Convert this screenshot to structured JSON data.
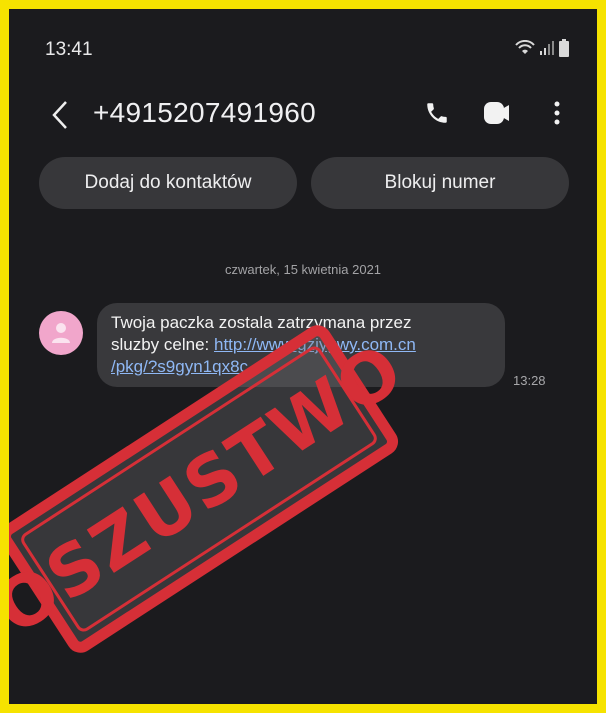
{
  "status_bar": {
    "time": "13:41",
    "icons": [
      "wifi-icon",
      "signal-icon",
      "battery-icon"
    ]
  },
  "header": {
    "back_icon": "chevron-left-icon",
    "phone_number": "+4915207491960",
    "actions": [
      "phone-icon",
      "video-call-icon",
      "more-icon"
    ]
  },
  "actions": {
    "add_contact": "Dodaj do kontaktów",
    "block_number": "Blokuj numer"
  },
  "conversation": {
    "date": "czwartek, 15 kwietnia 2021",
    "messages": [
      {
        "text_line1": "Twoja paczka zostala zatrzymana przez",
        "text_line2_prefix": "sluzby celne: ",
        "link_part1": "http://www.gzjygwy.com.cn",
        "link_part2": "/pkg/?s9gyn1qx8c",
        "time": "13:28"
      }
    ]
  },
  "stamp": {
    "text": "OSZUSTWO",
    "color": "#d62f37"
  },
  "colors": {
    "frame_border": "#f6e300",
    "background": "#1b1b1e",
    "bubble": "#39393c",
    "link": "#8fb8f5",
    "avatar": "#f1a6cb"
  }
}
